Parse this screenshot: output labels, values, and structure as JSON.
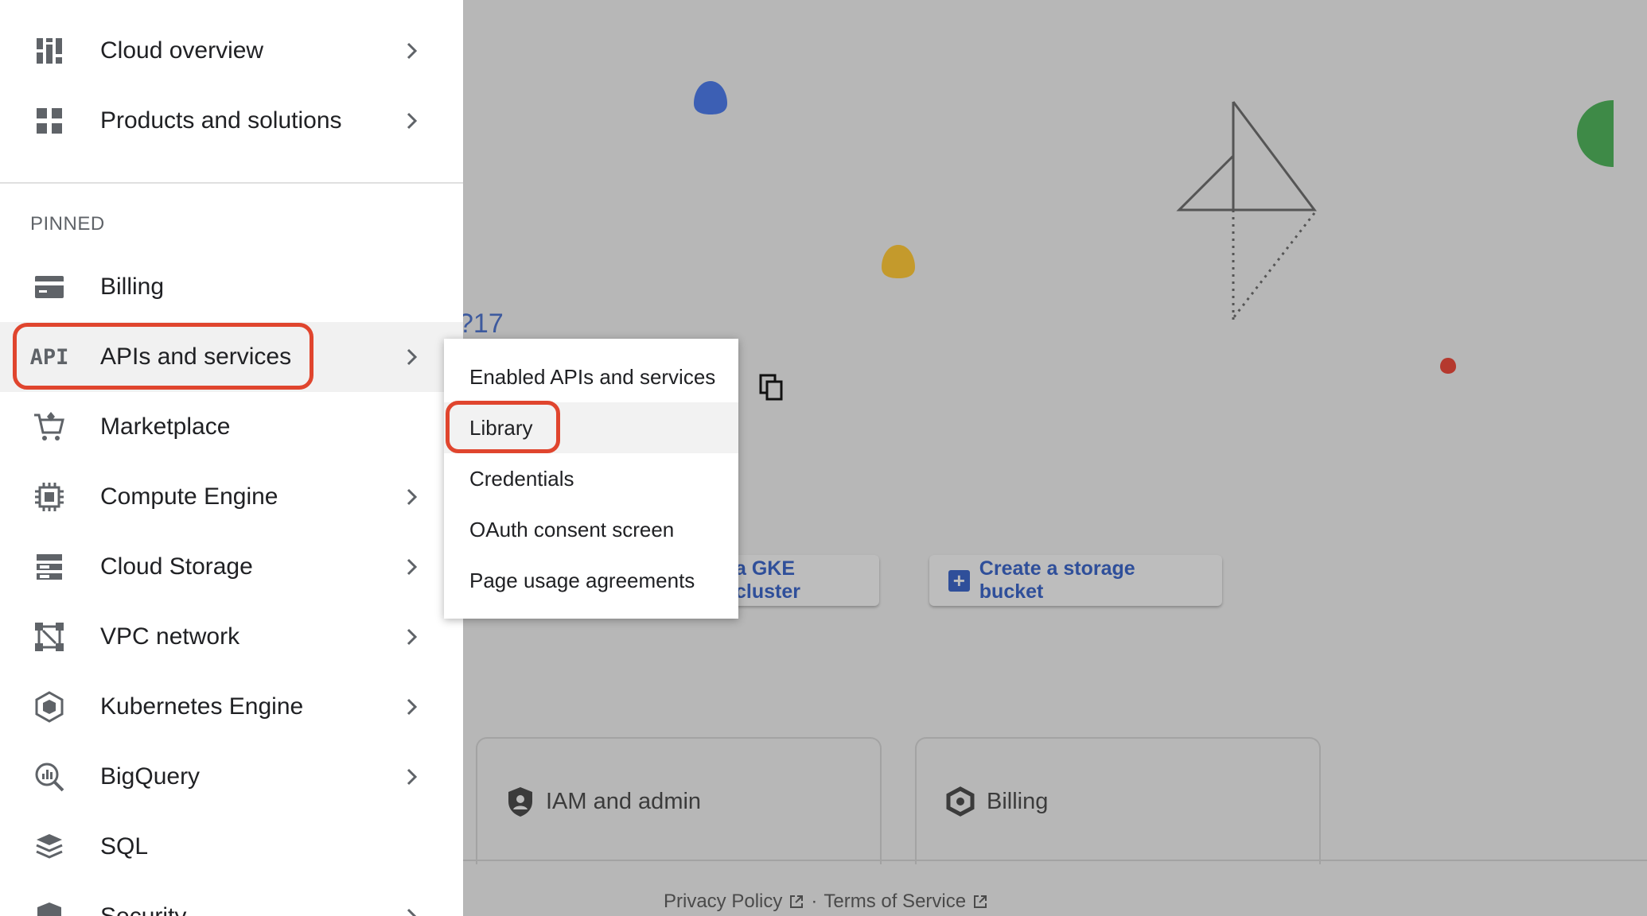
{
  "nav": {
    "top_items": [
      {
        "label": "Cloud overview",
        "icon": "dashboard-icon",
        "has_submenu": true
      },
      {
        "label": "Products and solutions",
        "icon": "grid-icon",
        "has_submenu": true
      }
    ],
    "section_label": "PINNED",
    "pinned_items": [
      {
        "label": "Billing",
        "icon": "billing-icon",
        "has_submenu": false
      },
      {
        "label": "APIs and services",
        "icon": "api-icon",
        "icon_text": "API",
        "has_submenu": true,
        "active": true
      },
      {
        "label": "Marketplace",
        "icon": "cart-icon",
        "has_submenu": false
      },
      {
        "label": "Compute Engine",
        "icon": "chip-icon",
        "has_submenu": true
      },
      {
        "label": "Cloud Storage",
        "icon": "storage-icon",
        "has_submenu": true
      },
      {
        "label": "VPC network",
        "icon": "network-icon",
        "has_submenu": true
      },
      {
        "label": "Kubernetes Engine",
        "icon": "kubernetes-icon",
        "has_submenu": true
      },
      {
        "label": "BigQuery",
        "icon": "bigquery-icon",
        "has_submenu": true
      },
      {
        "label": "SQL",
        "icon": "sql-icon",
        "has_submenu": false
      },
      {
        "label": "Security",
        "icon": "security-icon",
        "has_submenu": true
      }
    ]
  },
  "submenu": {
    "items": [
      {
        "label": "Enabled APIs and services"
      },
      {
        "label": "Library",
        "active": true
      },
      {
        "label": "Credentials"
      },
      {
        "label": "OAuth consent screen"
      },
      {
        "label": "Page usage agreements"
      }
    ]
  },
  "background": {
    "project_id_fragment": "?17",
    "buttons": [
      {
        "label": "a GKE cluster"
      },
      {
        "label": "Create a storage bucket"
      }
    ],
    "cards": [
      {
        "label": "IAM and admin",
        "icon": "shield-icon"
      },
      {
        "label": "Billing",
        "icon": "billing-hex-icon"
      }
    ],
    "footer": {
      "privacy": "Privacy Policy",
      "separator": "·",
      "terms": "Terms of Service"
    }
  },
  "colors": {
    "highlight": "#e0452e",
    "link_blue": "#2f4f9a",
    "overlay_gray": "#b7b7b7"
  }
}
